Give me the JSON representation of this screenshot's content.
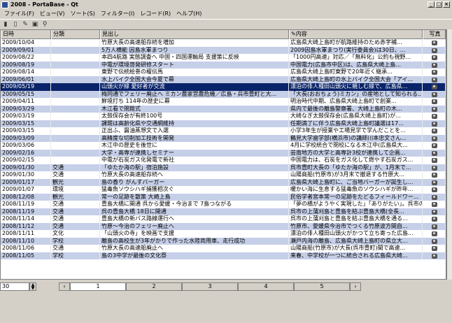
{
  "window": {
    "title": "2008 - PortaBase - Qt"
  },
  "menu": [
    "ファイル(F)",
    "ビュー(V)",
    "ソート(S)",
    "フィルター(I)",
    "レコード(R)",
    "ヘルプ(H)"
  ],
  "columns": {
    "date": "日時",
    "category": "分類",
    "headline": "見出し",
    "content": "内容",
    "photo": "写真"
  },
  "rows": [
    {
      "date": "2009/10/04",
      "category": "",
      "headline": "竹原大長の高速船存続を増加",
      "content": "広島県大崎上島町が航路維持のため赤字補..."
    },
    {
      "date": "2009/09/01",
      "category": "",
      "headline": "5万人横能 因島水軍まつり",
      "content": "2009因島水軍まつり(実行委員会)は30日、..."
    },
    {
      "date": "2009/08/22",
      "category": "",
      "headline": "本四4航路 実態調査へ 中国・四国運輸局 支援策に反映",
      "content": "「1000円高速」対応／「無料化」公約も視野..."
    },
    {
      "date": "2009/08/19",
      "category": "",
      "headline": "中電が環境啓発研修スタート",
      "content": "中国電力(広島市中区)は、広島県大崎上島..."
    },
    {
      "date": "2009/08/14",
      "category": "",
      "headline": "東野で伝統絵巻の櫂伝馬",
      "content": "広島県大崎上島町東野で20年近く継承..."
    },
    {
      "date": "2009/06/01",
      "category": "",
      "headline": "水上バイク全国大会今夏で幕",
      "content": "広島県大崎上島町の水上バイク全国大会「アイ..."
    },
    {
      "date": "2009/05/19",
      "category": "",
      "headline": "山頭火が縁 愛好者が交流",
      "content": "漂泊の俳人種田山頭火に親しむ縁で、広島県..."
    },
    {
      "date": "2009/05/15",
      "category": "",
      "headline": "梅同通でフェリー廃止へ ミカン農家営農危機／広島・兵市豊町と大...",
      "content": "「大長(おおちょう)ミカン」の産地として知られる..."
    },
    {
      "date": "2009/04/11",
      "category": "",
      "headline": "鮮境打ち 114年の歴史に幕",
      "content": "明治時代中期、広島県大崎上島町で創業..."
    },
    {
      "date": "2009/03/29",
      "category": "",
      "headline": "木江看で閉館式",
      "content": "県内で最後の離島警察署、大崎上島町の木..."
    },
    {
      "date": "2009/03/19",
      "category": "",
      "headline": "太鼓保存会が有終100号",
      "content": "大崎なぎ太鼓保存会(広島県大崎上島町)が..."
    },
    {
      "date": "2009/03/15",
      "category": "",
      "headline": "課題は高齢化県や交通網維持",
      "content": "任期満了に伴う広島県大崎上島町議選は17..."
    },
    {
      "date": "2009/03/15",
      "category": "",
      "headline": "正出ふ、醤油蒸想文で入選",
      "content": "小学3年生が授業や工場見学で学んだことを..."
    },
    {
      "date": "2009/03/09",
      "category": "",
      "headline": "高精度な切削加工技術を開発",
      "content": "鶴見大学歯学部(横浜市)の講師川本忠文さん..."
    },
    {
      "date": "2009/03/06",
      "category": "",
      "headline": "木江中の歴史を後世に",
      "content": "4月に学校統合で閉校になる木江中(広島県大..."
    },
    {
      "date": "2009/02/16",
      "category": "",
      "headline": "大学・高専が連携しセミナー",
      "content": "芸南地方の大学と高専計3校が連携して企画..."
    },
    {
      "date": "2009/02/15",
      "category": "",
      "headline": "中電が石炭ガス化発電で新社",
      "content": "中国電力は、石炭をガス化して燃やす石炭ガス..."
    },
    {
      "date": "2009/01/30",
      "category": "交通",
      "headline": "「ゆたか海の駅」宿泊施設",
      "content": "呉市豊町大長の「ゆたか海の駅」が、1月末で..."
    },
    {
      "date": "2009/01/30",
      "category": "交通",
      "headline": "竹原大長の高速船存続へ",
      "content": "山陽商船(竹原市)が3月末で撤退する竹原大..."
    },
    {
      "date": "2009/01/17",
      "category": "観光",
      "headline": "島の香り がんすバーガー",
      "content": "広島県大崎上島町に、ご当地バーガーが誕生し..."
    },
    {
      "date": "2009/01/07",
      "category": "環境",
      "headline": "猛毒魚ソウシハギ捕獲相次ぐ",
      "content": "暖かい海に生息する猛毒魚のソウシハギが昨年..."
    },
    {
      "date": "2008/12/08",
      "category": "観光",
      "headline": "常一の足跡を散策 大崎上島",
      "content": "民俗学者宮本常一の足跡をたどるフィールドワー..."
    },
    {
      "date": "2008/11/19",
      "category": "交通",
      "headline": "豊島大橋に開通 呉から愛媛・今治まで 7島つながる",
      "content": "「夢の橋がようやく実現した」「ありがたい」。呉市の上蒲刈島..."
    },
    {
      "date": "2008/11/19",
      "category": "交通",
      "headline": "呉の豊島大橋 18日に開通",
      "content": "呉市の上蒲刈島と豊島を結ぶ豊島大橋(全長..."
    },
    {
      "date": "2008/11/14",
      "category": "交通",
      "headline": "豊島大橋の新バス路線運行へ",
      "content": "呉市の上蒲刈島と豊島を結ぶ豊島大橋を通る..."
    },
    {
      "date": "2008/11/12",
      "category": "交通",
      "headline": "竹原～今治のフェリー廃止へ",
      "content": "竹原市、愛媛県今治市でつくる竹原波方間自..."
    },
    {
      "date": "2008/11/11",
      "category": "文化",
      "headline": "「山頭火の寺」を映画で支援",
      "content": "漂泊の俳人種田山頭火がかつて立ち寄った広島..."
    },
    {
      "date": "2008/11/10",
      "category": "学校",
      "headline": "離島の高校生が3年がかりで作った水陸両用車、走行成功",
      "content": "瀬戸内海の離島、広島県大崎上島町の県立大..."
    },
    {
      "date": "2008/11/06",
      "category": "交通",
      "headline": "竹原大長の高速船廃止へ",
      "content": "山陽商船(竹原市)が大長(呉市豊町)間で高速..."
    },
    {
      "date": "2008/11/05",
      "category": "学校",
      "headline": "島の3中学が最後の文化祭",
      "content": "来春、中学校が一つに統合される広島県大崎..."
    }
  ],
  "selected_row_index": 6,
  "pager": {
    "page_size": "30",
    "pages": [
      "1",
      "2",
      "3",
      "4",
      "5"
    ],
    "current_page": "1",
    "prev_label": "‹",
    "next_label": "›"
  },
  "colors": {
    "alt_row": "#c6cfe8",
    "selected_row": "#0a246a"
  },
  "icons": {
    "photo": "camera-icon"
  }
}
